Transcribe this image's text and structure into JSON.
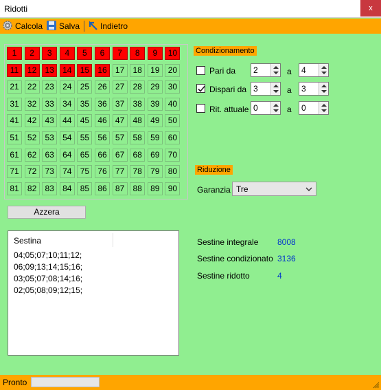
{
  "window": {
    "title": "Ridotti",
    "close_label": "x"
  },
  "toolbar": {
    "calcola": "Calcola",
    "salva": "Salva",
    "indietro": "Indietro"
  },
  "grid": {
    "numbers": [
      "1",
      "2",
      "3",
      "4",
      "5",
      "6",
      "7",
      "8",
      "9",
      "10",
      "11",
      "12",
      "13",
      "14",
      "15",
      "16",
      "17",
      "18",
      "19",
      "20",
      "21",
      "22",
      "23",
      "24",
      "25",
      "26",
      "27",
      "28",
      "29",
      "30",
      "31",
      "32",
      "33",
      "34",
      "35",
      "36",
      "37",
      "38",
      "39",
      "40",
      "41",
      "42",
      "43",
      "44",
      "45",
      "46",
      "47",
      "48",
      "49",
      "50",
      "51",
      "52",
      "53",
      "54",
      "55",
      "56",
      "57",
      "58",
      "59",
      "60",
      "61",
      "62",
      "63",
      "64",
      "65",
      "66",
      "67",
      "68",
      "69",
      "70",
      "71",
      "72",
      "73",
      "74",
      "75",
      "76",
      "77",
      "78",
      "79",
      "80",
      "81",
      "82",
      "83",
      "84",
      "85",
      "86",
      "87",
      "88",
      "89",
      "90"
    ],
    "selected": [
      1,
      2,
      3,
      4,
      5,
      6,
      7,
      8,
      9,
      10,
      11,
      12,
      13,
      14,
      15,
      16
    ]
  },
  "condizionamento": {
    "title": "Condizionamento",
    "a_label": "a",
    "rows": [
      {
        "label": "Pari da",
        "checked": false,
        "from": "2",
        "to": "4"
      },
      {
        "label": "Dispari da",
        "checked": true,
        "from": "3",
        "to": "3"
      },
      {
        "label": "Rit. attuale",
        "checked": false,
        "from": "0",
        "to": "0"
      }
    ]
  },
  "riduzione": {
    "title": "Riduzione",
    "garanzia_label": "Garanzia",
    "garanzia_value": "Tre"
  },
  "azzera_label": "Azzera",
  "sestine": {
    "header": "Sestina",
    "items": [
      "04;05;07;10;11;12;",
      "06;09;13;14;15;16;",
      "03;05;07;08;14;16;",
      "02;05;08;09;12;15;"
    ]
  },
  "stats": [
    {
      "label": "Sestine integrale",
      "value": "8008"
    },
    {
      "label": "Sestine condizionato",
      "value": "3136"
    },
    {
      "label": "Sestine ridotto",
      "value": "4"
    }
  ],
  "status": {
    "text": "Pronto"
  },
  "colors": {
    "accent": "#ffa500",
    "background": "#90ee90",
    "selected": "#ff0000",
    "value_blue": "#0033cc"
  }
}
